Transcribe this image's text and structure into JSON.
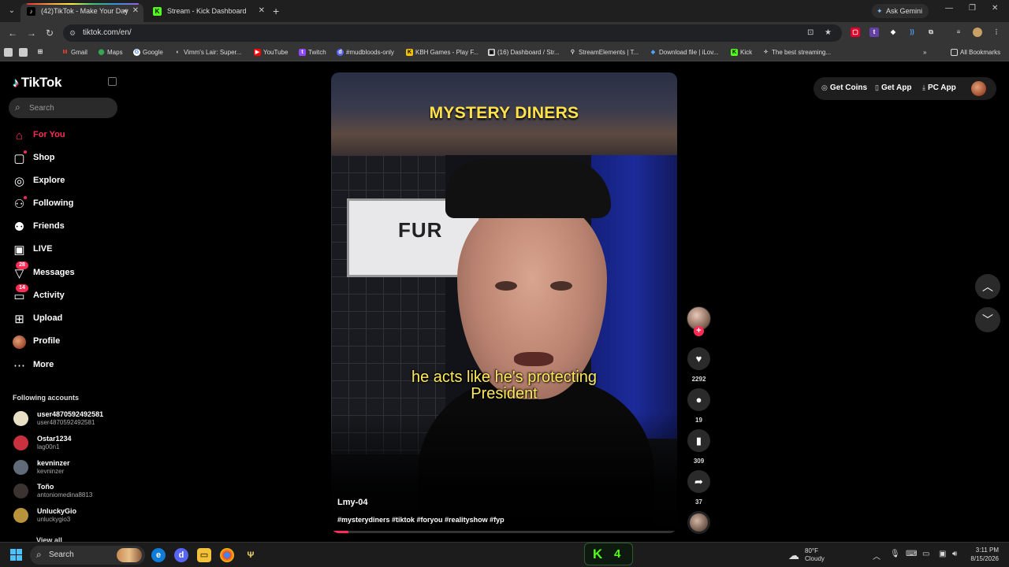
{
  "browser": {
    "tabs": [
      {
        "label": "(42)TikTok - Make Your Day",
        "active": true
      },
      {
        "label": "Stream - Kick Dashboard",
        "active": false
      }
    ],
    "ask_gemini": "Ask Gemini",
    "url": "tiktok.com/en/",
    "bookmarks": [
      {
        "label": "Gmail",
        "icon": "gmail-icon"
      },
      {
        "label": "Maps",
        "icon": "maps-icon"
      },
      {
        "label": "Google",
        "icon": "google-icon"
      },
      {
        "label": "Vimm's Lair: Super...",
        "icon": "vimm-icon"
      },
      {
        "label": "YouTube",
        "icon": "youtube-icon"
      },
      {
        "label": "Twitch",
        "icon": "twitch-icon"
      },
      {
        "label": "#mudbloods-only",
        "icon": "discord-icon"
      },
      {
        "label": "KBH Games - Play F...",
        "icon": "kbh-icon"
      },
      {
        "label": "(16) Dashboard / Str...",
        "icon": "dashboard-icon"
      },
      {
        "label": "StreamElements | T...",
        "icon": "streamelements-icon"
      },
      {
        "label": "Download file | iLov...",
        "icon": "ilovepdf-icon"
      },
      {
        "label": "Kick",
        "icon": "kick-icon"
      },
      {
        "label": "The best streaming...",
        "icon": "streaming-icon"
      }
    ],
    "all_bookmarks": "All Bookmarks"
  },
  "tiktok": {
    "logo": "TikTok",
    "search_placeholder": "Search",
    "nav": [
      {
        "label": "For You",
        "icon": "home-icon",
        "active": true
      },
      {
        "label": "Shop",
        "icon": "shop-bag-icon"
      },
      {
        "label": "Explore",
        "icon": "compass-icon"
      },
      {
        "label": "Following",
        "icon": "following-icon"
      },
      {
        "label": "Friends",
        "icon": "friends-icon"
      },
      {
        "label": "LIVE",
        "icon": "live-tv-icon"
      },
      {
        "label": "Messages",
        "icon": "messages-icon",
        "badge": "28"
      },
      {
        "label": "Activity",
        "icon": "activity-icon",
        "badge": "14"
      },
      {
        "label": "Upload",
        "icon": "upload-icon"
      },
      {
        "label": "Profile",
        "icon": "profile-avatar-icon"
      },
      {
        "label": "More",
        "icon": "more-dots-icon"
      }
    ],
    "following_title": "Following accounts",
    "following": [
      {
        "name": "user4870592492581",
        "handle": "user4870592492581",
        "color": "#e9dfc4"
      },
      {
        "name": "Ostar1234",
        "handle": "lag00n1",
        "color": "#c9313f"
      },
      {
        "name": "kevninzer",
        "handle": "kevninzer",
        "color": "#606a78"
      },
      {
        "name": "Toño",
        "handle": "antoniomedina8813",
        "color": "#3a3330"
      },
      {
        "name": "UnluckyGio",
        "handle": "unluckygio3",
        "color": "#b8933c"
      }
    ],
    "view_all": "View all",
    "top_actions": {
      "coins": "Get Coins",
      "app": "Get App",
      "pc": "PC App"
    },
    "video": {
      "overlay_title": "MYSTERY DINERS",
      "sign_text": "FUR",
      "subtitle_line1": "he acts like he's protecting",
      "subtitle_line2": "President",
      "author": "Lmy-04",
      "hashtags": "#mysterydiners #tiktok #foryou #realityshow #fyp",
      "progress": 0.05
    },
    "actions": {
      "likes": "2292",
      "comments": "19",
      "saves": "309",
      "shares": "37"
    }
  },
  "taskbar": {
    "search": "Search",
    "kick_label": "K",
    "kick_count": "4",
    "weather_temp": "80°F",
    "weather_desc": "Cloudy",
    "time": "3:11 PM",
    "date": "8/15/2026"
  },
  "colors": {
    "accent": "#fe2c55",
    "kick_green": "#53fc18",
    "subtitle_yellow": "#ffe95c"
  }
}
